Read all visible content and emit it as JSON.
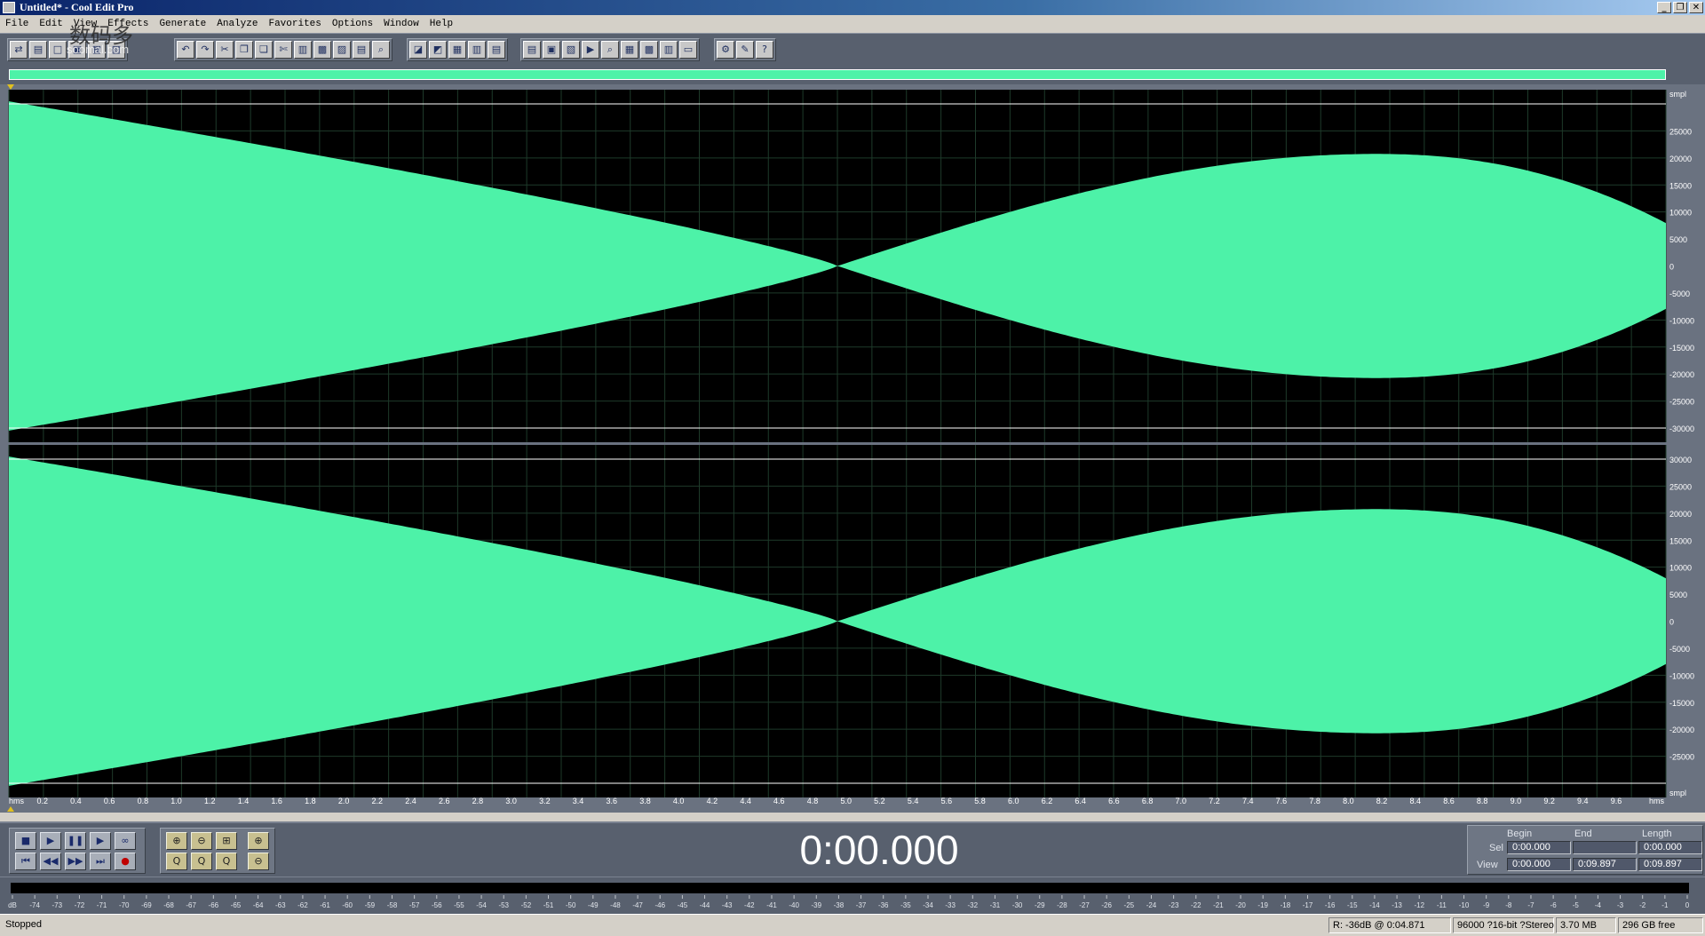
{
  "window": {
    "title": "Untitled* - Cool Edit Pro",
    "buttons": {
      "minimize": "_",
      "restore": "❐",
      "close": "✕"
    }
  },
  "watermark": {
    "text": "数码多",
    "sub": "soomal.com"
  },
  "menu": [
    "File",
    "Edit",
    "View",
    "Effects",
    "Generate",
    "Analyze",
    "Favorites",
    "Options",
    "Window",
    "Help"
  ],
  "waveform": {
    "color": "#4df2a8",
    "background": "#000000",
    "amplitude_unit": "smpl",
    "amplitude_ticks": [
      "25000",
      "20000",
      "15000",
      "10000",
      "5000",
      "0",
      "-5000",
      "-10000",
      "-15000",
      "-20000",
      "-25000",
      "-30000"
    ],
    "amplitude_ticks_right_top": [
      "smpl",
      "25000",
      "20000",
      "15000",
      "10000",
      "5000",
      "0",
      "-5000",
      "-10000",
      "-15000",
      "-20000",
      "-25000",
      "-30000"
    ],
    "amplitude_ticks_right_bottom": [
      "30000",
      "25000",
      "20000",
      "15000",
      "10000",
      "5000",
      "0",
      "-5000",
      "-10000",
      "-15000",
      "-20000",
      "-25000",
      "smpl"
    ],
    "time_unit": "hms",
    "time_ticks": [
      "0.2",
      "0.4",
      "0.6",
      "0.8",
      "1.0",
      "1.2",
      "1.4",
      "1.6",
      "1.8",
      "2.0",
      "2.2",
      "2.4",
      "2.6",
      "2.8",
      "3.0",
      "3.2",
      "3.4",
      "3.6",
      "3.8",
      "4.0",
      "4.2",
      "4.4",
      "4.6",
      "4.8",
      "5.0",
      "5.2",
      "5.4",
      "5.6",
      "5.8",
      "6.0",
      "6.2",
      "6.4",
      "6.6",
      "6.8",
      "7.0",
      "7.2",
      "7.4",
      "7.6",
      "7.8",
      "8.0",
      "8.2",
      "8.4",
      "8.6",
      "8.8",
      "9.0",
      "9.2",
      "9.4",
      "9.6"
    ],
    "channels": [
      "left",
      "right"
    ]
  },
  "transport": {
    "buttons": {
      "stop": "■",
      "play": "▶",
      "pause": "❚❚",
      "play_to_end": "▶",
      "loop": "∞",
      "go_start": "⏮",
      "rewind": "◀◀",
      "forward": "▶▶",
      "go_end": "⏭",
      "record": "●"
    },
    "zoom_buttons": {
      "zoom_in_h": "⊕",
      "zoom_out_h": "⊖",
      "zoom_full": "⊞",
      "zoom_in_v": "⊕",
      "zoom_left": "Q",
      "zoom_right": "Q",
      "zoom_sel": "Q",
      "zoom_out_v": "⊖"
    },
    "time_display": "0:00.000"
  },
  "selection": {
    "headers": {
      "begin": "Begin",
      "end": "End",
      "length": "Length"
    },
    "sel": {
      "label": "Sel",
      "begin": "0:00.000",
      "end": "",
      "length": "0:00.000"
    },
    "view": {
      "label": "View",
      "begin": "0:00.000",
      "end": "0:09.897",
      "length": "0:09.897"
    }
  },
  "meter": {
    "ticks": [
      "dB",
      "-74",
      "-73",
      "-72",
      "-71",
      "-70",
      "-69",
      "-68",
      "-67",
      "-66",
      "-65",
      "-64",
      "-63",
      "-62",
      "-61",
      "-60",
      "-59",
      "-58",
      "-57",
      "-56",
      "-55",
      "-54",
      "-53",
      "-52",
      "-51",
      "-50",
      "-49",
      "-48",
      "-47",
      "-46",
      "-45",
      "-44",
      "-43",
      "-42",
      "-41",
      "-40",
      "-39",
      "-38",
      "-37",
      "-36",
      "-35",
      "-34",
      "-33",
      "-32",
      "-31",
      "-30",
      "-29",
      "-28",
      "-27",
      "-26",
      "-25",
      "-24",
      "-23",
      "-22",
      "-21",
      "-20",
      "-19",
      "-18",
      "-17",
      "-16",
      "-15",
      "-14",
      "-13",
      "-12",
      "-11",
      "-10",
      "-9",
      "-8",
      "-7",
      "-6",
      "-5",
      "-4",
      "-3",
      "-2",
      "-1",
      "0"
    ]
  },
  "status": {
    "state": "Stopped",
    "level": "R: -36dB @   0:04.871",
    "format": "96000 ?16-bit ?Stereo",
    "size": "3.70 MB",
    "free": "296 GB free"
  }
}
